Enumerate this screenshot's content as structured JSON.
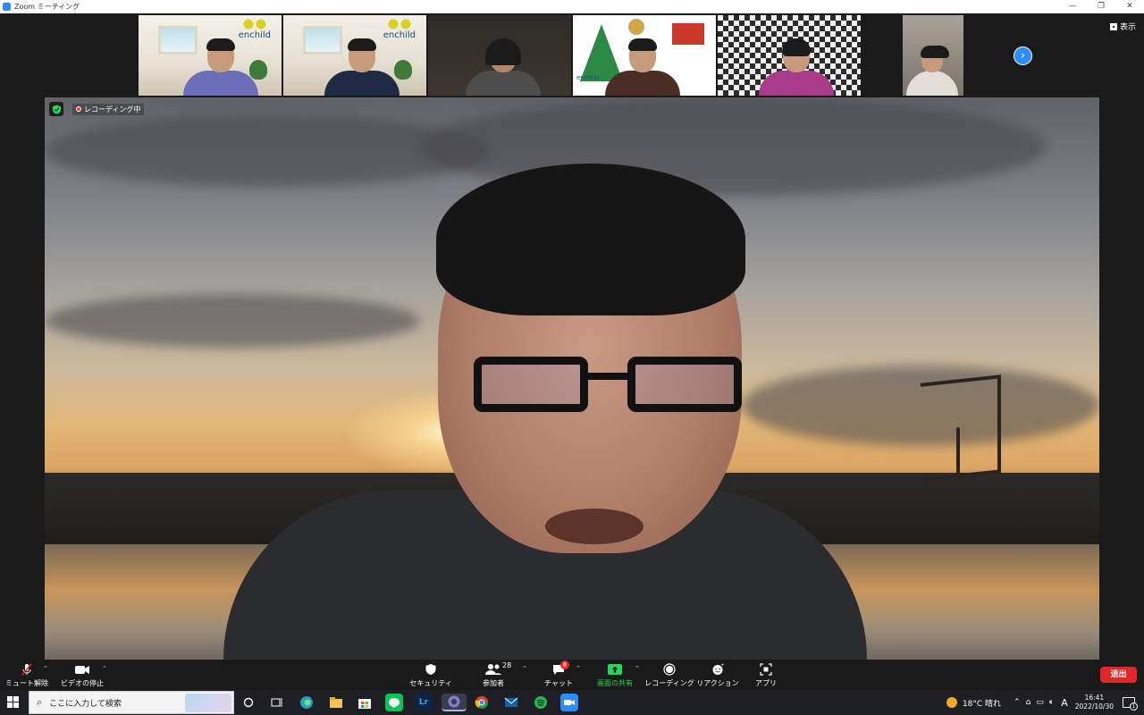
{
  "window": {
    "title": "Zoom ミーティング",
    "controls": [
      "—",
      "❐",
      "✕"
    ]
  },
  "meeting": {
    "view_label": "表示",
    "recording_label": "レコーディング中",
    "thumbnails": [
      {
        "name_on_bg": "enchild"
      },
      {
        "name_on_bg": "enchild"
      },
      {
        "name_on_bg": ""
      },
      {
        "name_on_bg": "enchild"
      },
      {
        "name_on_bg": ""
      },
      {
        "name_on_bg": ""
      }
    ]
  },
  "toolbar": {
    "mute_label": "ミュート解除",
    "video_label": "ビデオの停止",
    "security_label": "セキュリティ",
    "participants_label": "参加者",
    "participants_count": "28",
    "chat_label": "チャット",
    "chat_count": "8",
    "share_label": "画面の共有",
    "record_label": "レコーディング",
    "reactions_label": "リアクション",
    "apps_label": "アプリ",
    "leave_label": "退出"
  },
  "taskbar": {
    "search_placeholder": "ここに入力して検索",
    "weather": "18°C 晴れ",
    "ime": "A",
    "time": "16:41",
    "date": "2022/10/30",
    "notification_count": "1",
    "apps": [
      "edge",
      "explorer",
      "store",
      "line",
      "lightroom",
      "active-app",
      "chrome",
      "mail",
      "spotify",
      "zoom"
    ]
  },
  "colors": {
    "zoom_blue": "#2d8cff",
    "leave_red": "#e02828",
    "share_green": "#23d959",
    "toolbar_bg": "#1a1a1a"
  }
}
